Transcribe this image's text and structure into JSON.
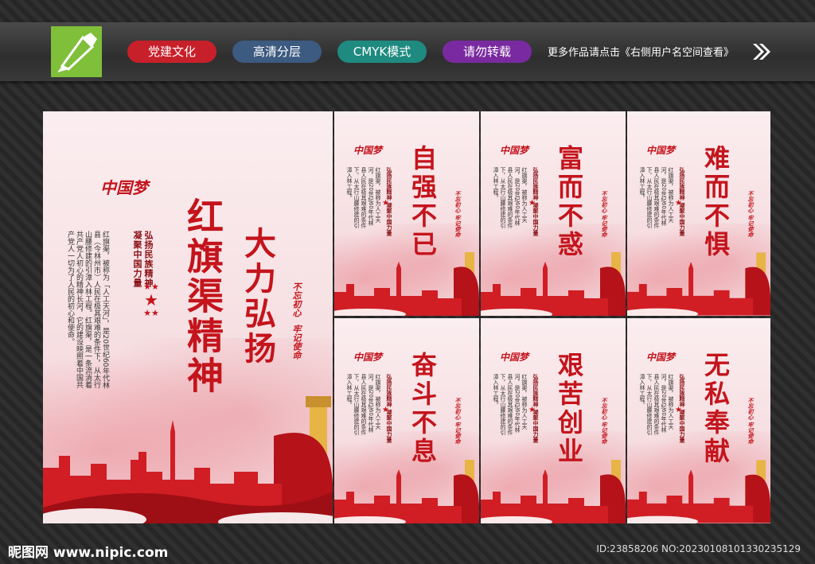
{
  "toolbar": {
    "tags": [
      {
        "label": "党建文化",
        "color": "#c8202a"
      },
      {
        "label": "高清分层",
        "color": "#3d5a80"
      },
      {
        "label": "CMYK模式",
        "color": "#1f8a80"
      },
      {
        "label": "请勿转载",
        "color": "#7a2aa0"
      }
    ],
    "notice": "更多作品请点击《右侧用户名空间查看》"
  },
  "main_poster": {
    "title": "红旗渠精神",
    "slogan": "大力弘扬",
    "subtitle_a": "弘扬民族精神",
    "subtitle_b": "凝聚中国力量",
    "body": "红旗渠，被称为「人工天河」，是20世纪60年代林县（今林州市）人民在极其艰难的条件下，从太行山腰修建的引漳入林工程。红旗渠，是一条流淌着共产党人初心的精神长河，它的建设映照着中国共产党人一切为了人民的初心和使命。",
    "seal_a": "不忘初心",
    "seal_b": "牢记使命",
    "mark": "中国梦"
  },
  "small_posters": [
    {
      "title": "自强不已"
    },
    {
      "title": "富而不惑"
    },
    {
      "title": "难而不惧"
    },
    {
      "title": "奋斗不息"
    },
    {
      "title": "艰苦创业"
    },
    {
      "title": "无私奉献"
    }
  ],
  "small_common": {
    "subtitle": "弘扬民族精神 凝聚中国力量",
    "seal": "不忘初心 牢记使命",
    "mark": "中国梦",
    "body": "红旗渠，被称为人工天河，是20世纪60年代林县人民在极其艰难的条件下，从太行山腰修建的引漳入林工程。"
  },
  "footer": {
    "site": "昵图网 www.nipic.com",
    "id": "ID:23858206 NO:20230108101330235129"
  }
}
